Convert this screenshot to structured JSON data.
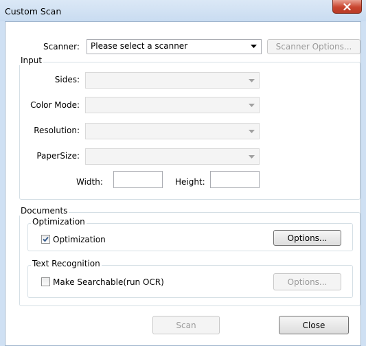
{
  "window": {
    "title": "Custom Scan",
    "close_icon": "close-icon"
  },
  "scanner": {
    "label": "Scanner:",
    "selected": "Please select a scanner",
    "options_button": "Scanner Options..."
  },
  "input_group": {
    "legend": "Input",
    "sides_label": "Sides:",
    "color_mode_label": "Color Mode:",
    "resolution_label": "Resolution:",
    "paper_size_label": "PaperSize:",
    "width_label": "Width:",
    "height_label": "Height:",
    "width_value": "",
    "height_value": ""
  },
  "documents_group": {
    "legend": "Documents",
    "optimization": {
      "legend": "Optimization",
      "checkbox_label": "Optimization",
      "checked": true,
      "options_button": "Options..."
    },
    "text_recognition": {
      "legend": "Text Recognition",
      "checkbox_label": "Make Searchable(run OCR)",
      "checked": false,
      "options_button": "Options..."
    }
  },
  "footer": {
    "scan_button": "Scan",
    "close_button": "Close"
  },
  "colors": {
    "title_bar": "#cfe0f3",
    "close_button": "#c9452f",
    "accent_check": "#3a5f8f"
  }
}
